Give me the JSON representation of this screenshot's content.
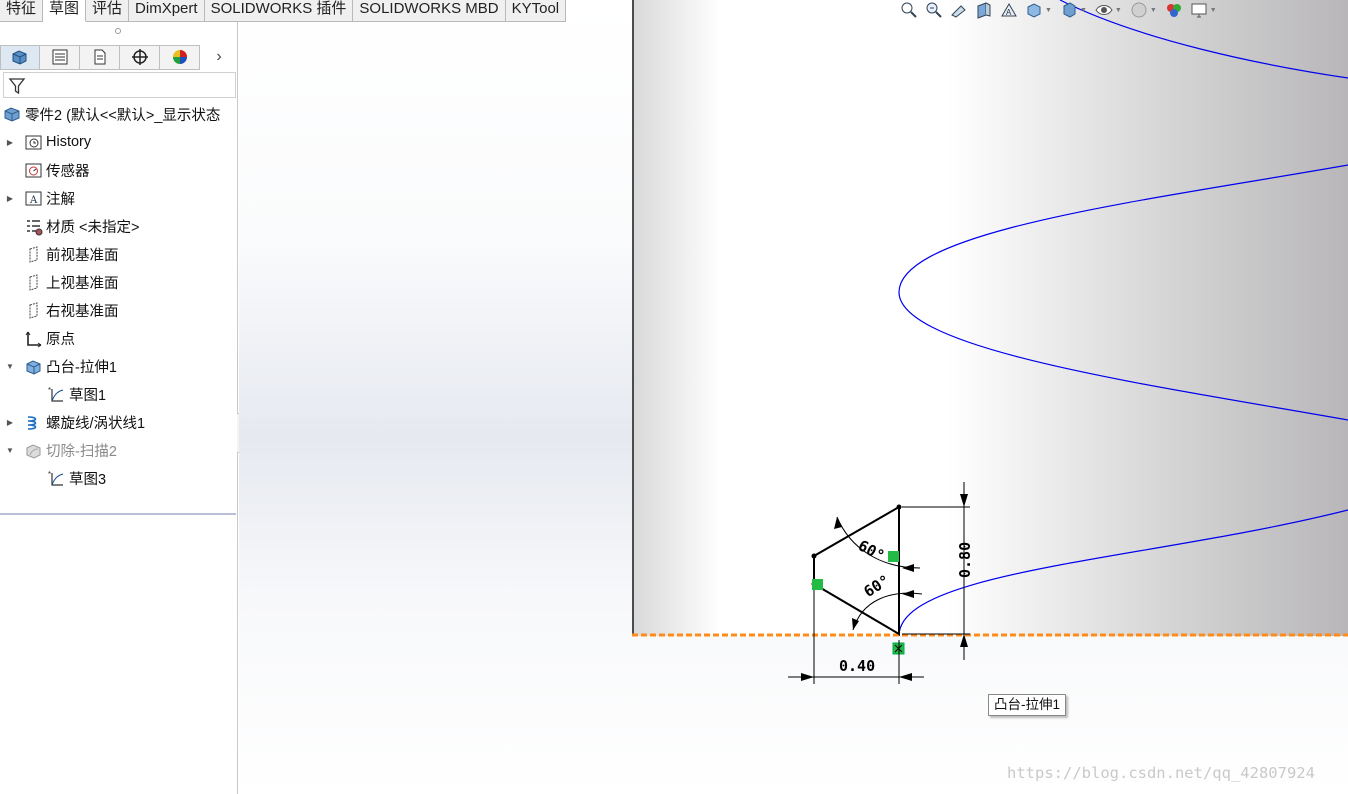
{
  "command_tabs": [
    "特征",
    "草图",
    "评估",
    "DimXpert",
    "SOLIDWORKS 插件",
    "SOLIDWORKS MBD",
    "KYTool"
  ],
  "active_tab_index": 1,
  "fm_tabs": [
    {
      "name": "featuremanager-tab",
      "icon": "part-tree-icon"
    },
    {
      "name": "propertymanager-tab",
      "icon": "property-list-icon"
    },
    {
      "name": "configurationmanager-tab",
      "icon": "configuration-icon"
    },
    {
      "name": "dimxpertmanager-tab",
      "icon": "crosshair-icon"
    },
    {
      "name": "displaymanager-tab",
      "icon": "color-wheel-icon"
    }
  ],
  "tree": {
    "root": "零件2  (默认<<默认>_显示状态",
    "items": [
      {
        "label": "History",
        "icon": "history-icon",
        "expander": "collapsed",
        "indent": 0,
        "dim": false
      },
      {
        "label": "传感器",
        "icon": "sensor-icon",
        "expander": "none",
        "indent": 0,
        "dim": false
      },
      {
        "label": "注解",
        "icon": "annotation-icon",
        "expander": "collapsed",
        "indent": 0,
        "dim": false
      },
      {
        "label": "材质 <未指定>",
        "icon": "material-icon",
        "expander": "none",
        "indent": 0,
        "dim": false
      },
      {
        "label": "前视基准面",
        "icon": "plane-icon",
        "expander": "none",
        "indent": 0,
        "dim": false
      },
      {
        "label": "上视基准面",
        "icon": "plane-icon",
        "expander": "none",
        "indent": 0,
        "dim": false
      },
      {
        "label": "右视基准面",
        "icon": "plane-icon",
        "expander": "none",
        "indent": 0,
        "dim": false
      },
      {
        "label": "原点",
        "icon": "origin-icon",
        "expander": "none",
        "indent": 0,
        "dim": false
      },
      {
        "label": "凸台-拉伸1",
        "icon": "boss-extrude-icon",
        "expander": "expanded",
        "indent": 0,
        "dim": false
      },
      {
        "label": "草图1",
        "icon": "sketch-icon",
        "expander": "none",
        "indent": 1,
        "dim": false
      },
      {
        "label": "螺旋线/涡状线1",
        "icon": "helix-icon",
        "expander": "collapsed",
        "indent": 0,
        "dim": false
      },
      {
        "label": "切除-扫描2",
        "icon": "cut-sweep-icon",
        "expander": "expanded",
        "indent": 0,
        "dim": true
      },
      {
        "label": "草图3",
        "icon": "sketch-icon",
        "expander": "none",
        "indent": 1,
        "dim": false
      }
    ]
  },
  "sketch": {
    "angle_top": "60°",
    "angle_bottom": "60°",
    "dim_horizontal": "0.40",
    "dim_vertical": "0.80"
  },
  "tooltip": "凸台-拉伸1",
  "watermark": "https://blog.csdn.net/qq_42807924",
  "heads_up_icons": [
    "zoom-to-fit-icon",
    "zoom-area-icon",
    "previous-view-icon",
    "section-view-icon",
    "dynamic-annotation-icon",
    "view-orientation-icon",
    "display-style-icon",
    "hide-show-icon",
    "edit-appearance-icon",
    "apply-scene-icon",
    "view-settings-icon"
  ],
  "colors": {
    "helix": "#0000ee",
    "edge_highlight": "#ff8c1a",
    "relation": "#22bb44"
  }
}
